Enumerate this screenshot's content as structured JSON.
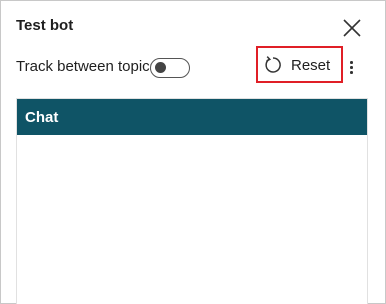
{
  "panel": {
    "title": "Test bot",
    "close_icon": "close-icon"
  },
  "toolbar": {
    "track_label": "Track between topics",
    "track_enabled": false,
    "reset_label": "Reset",
    "reset_icon": "refresh-icon",
    "more_icon": "more-vertical-icon",
    "highlight_color": "#e01f26"
  },
  "chat": {
    "header_label": "Chat",
    "header_color": "#0f5466"
  }
}
